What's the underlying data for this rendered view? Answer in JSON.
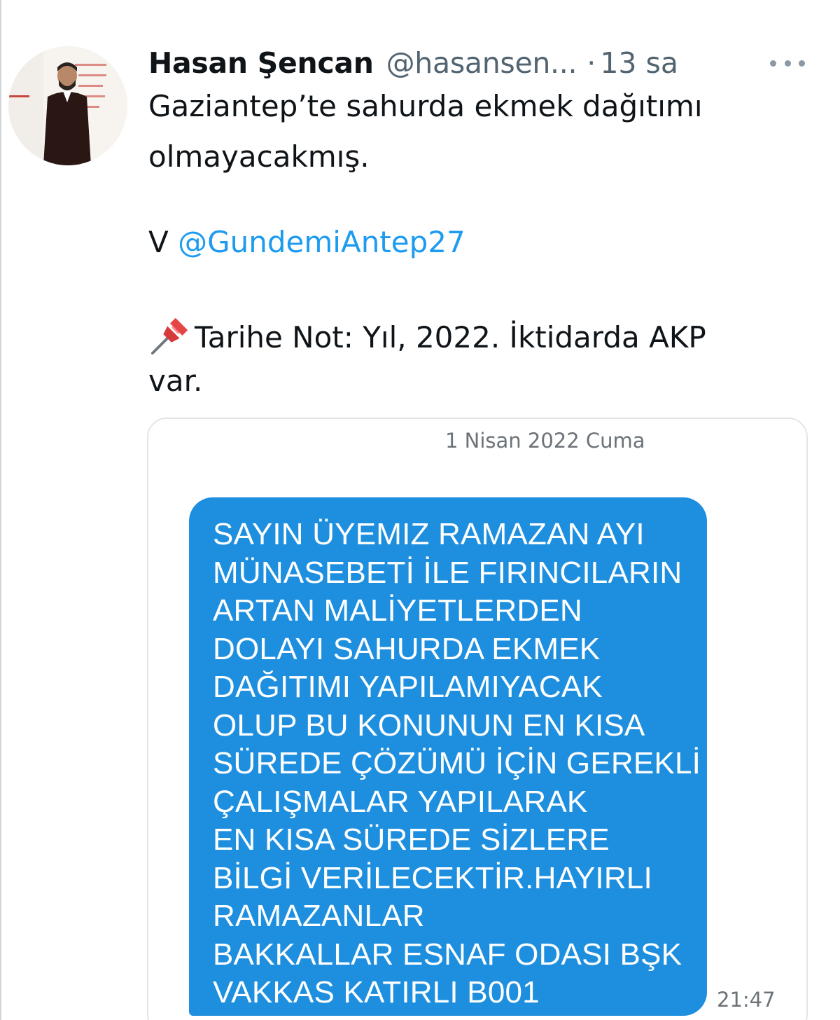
{
  "author": {
    "name": "Hasan Şencan",
    "handle": "@hasansen...",
    "separator": "·",
    "time": "13 sa"
  },
  "tweet": {
    "text_line1": "Gaziantep’te sahurda ekmek dağıtımı",
    "text_line2": "olmayacakmış.",
    "via_prefix": "V",
    "via_mention": "@GundemiAntep27",
    "note_line1": "Tarihe Not: Yıl, 2022. İktidarda AKP",
    "note_line2": "var.",
    "note_icon": "pushpin-icon"
  },
  "sms": {
    "date": "1 Nisan 2022 Cuma",
    "lines": [
      "SAYIN ÜYEMIZ RAMAZAN AYI",
      "MÜNASEBETİ İLE FIRINCILARIN",
      "ARTAN MALİYETLERDEN",
      "DOLAYI SAHURDA EKMEK",
      "DAĞITIMI YAPILAMIYACAK",
      "OLUP BU KONUNUN EN KISA",
      "SÜREDE ÇÖZÜMÜ İÇİN GEREKLİ",
      "ÇALIŞMALAR YAPILARAK",
      "EN KISA SÜREDE SİZLERE",
      "BİLGİ VERİLECEKTİR.HAYIRLI",
      "RAMAZANLAR",
      "BAKKALLAR ESNAF ODASI BŞK",
      "VAKKAS KATIRLI B001"
    ],
    "time": "21:47",
    "bubble_color": "#1e8fdf"
  },
  "colors": {
    "link": "#1d9bf0",
    "secondary_text": "#536471",
    "primary_text": "#0f1419"
  }
}
